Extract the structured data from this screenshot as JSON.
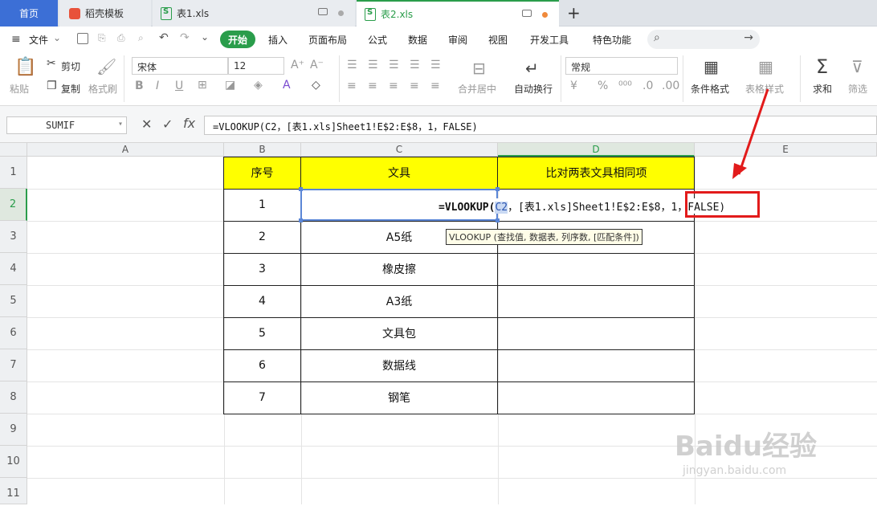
{
  "tabs": {
    "home": "首页",
    "template": "稻壳模板",
    "file1": "表1.xls",
    "file2": "表2.xls",
    "new_tab": "+"
  },
  "menu": {
    "file": "文件",
    "items": [
      "开始",
      "插入",
      "页面布局",
      "公式",
      "数据",
      "审阅",
      "视图",
      "开发工具",
      "特色功能"
    ]
  },
  "ribbon": {
    "paste": "粘贴",
    "cut": "剪切",
    "copy": "复制",
    "format_painter": "格式刷",
    "font_name": "宋体",
    "font_size": "12",
    "number_format": "常规",
    "merge_center": "合并居中",
    "wrap_text": "自动换行",
    "conditional_format": "条件格式",
    "table_style": "表格样式",
    "sum": "求和",
    "filter": "筛选",
    "currency": "¥",
    "percent": "%"
  },
  "formula_bar": {
    "name_box": "SUMIF",
    "formula": "=VLOOKUP(C2，[表1.xls]Sheet1!E$2:E$8，1，FALSE)"
  },
  "grid": {
    "columns": [
      "A",
      "B",
      "C",
      "D",
      "E"
    ],
    "rows": [
      "1",
      "2",
      "3",
      "4",
      "5",
      "6",
      "7",
      "8",
      "9",
      "10",
      "11"
    ],
    "headers": {
      "b": "序号",
      "c": "文具",
      "d": "比对两表文具相同项"
    },
    "b_values": [
      "1",
      "2",
      "3",
      "4",
      "5",
      "6",
      "7"
    ],
    "c_values": [
      "",
      "A5纸",
      "橡皮擦",
      "A3纸",
      "文具包",
      "数据线",
      "钢笔"
    ],
    "edit_cell": {
      "prefix": "=VLOOKUP(",
      "arg1": "C2",
      "rest": "，[表1.xls]Sheet1!E$2:E$8，1，FALSE)"
    },
    "tooltip": "VLOOKUP (查找值, 数据表, 列序数, [匹配条件])"
  },
  "watermark": {
    "brand": "Baidu经验",
    "url": "jingyan.baidu.com"
  },
  "colors": {
    "accent": "#2a9d4b",
    "header_fill": "#ffff00",
    "annotation": "#e21b1b",
    "home_tab": "#3c6fd6"
  }
}
